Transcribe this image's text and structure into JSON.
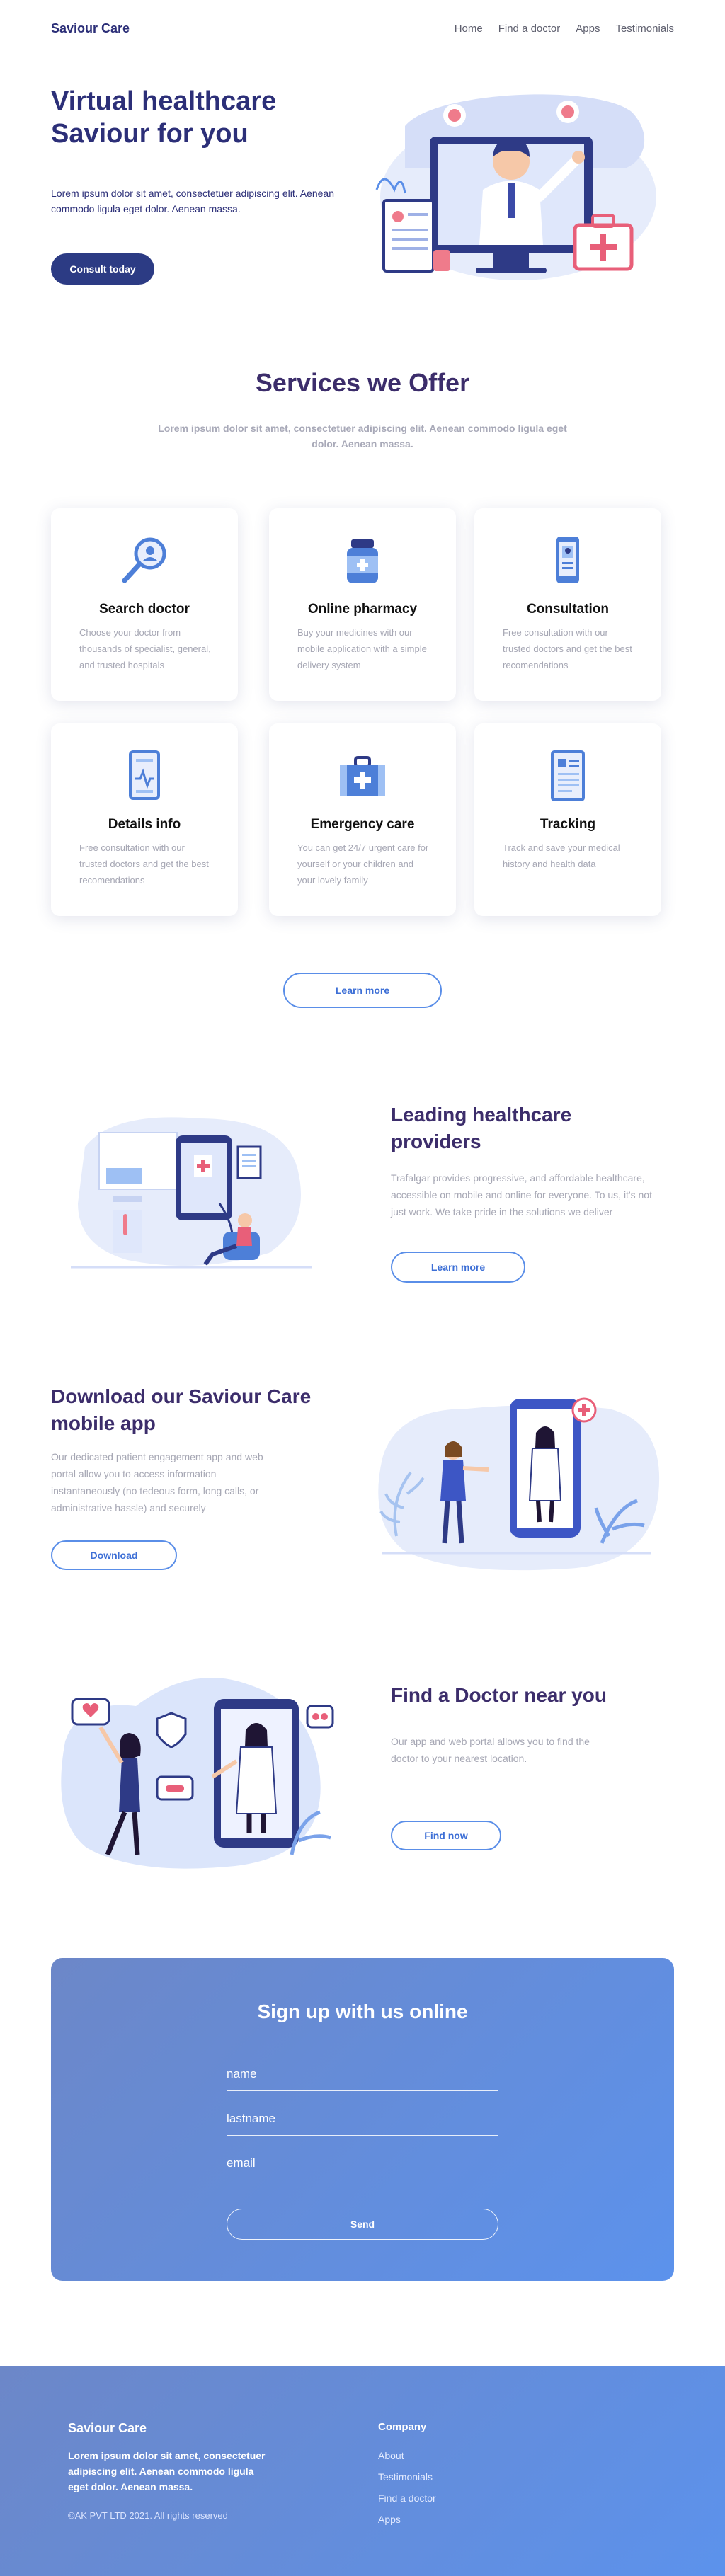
{
  "nav": {
    "brand": "Saviour Care",
    "links": [
      "Home",
      "Find a doctor",
      "Apps",
      "Testimonials"
    ]
  },
  "hero": {
    "title": "Virtual healthcare Saviour for you",
    "text": "Lorem ipsum dolor sit amet, consectetuer adipiscing elit. Aenean commodo ligula eget dolor. Aenean massa.",
    "button": "Consult today"
  },
  "services": {
    "title": "Services we Offer",
    "subtitle": "Lorem ipsum dolor sit amet, consectetuer adipiscing elit. Aenean commodo ligula eget dolor. Aenean massa.",
    "cards": [
      {
        "title": "Search doctor",
        "text": "Choose your doctor from thousands of specialist, general, and trusted hospitals",
        "icon": "search-doctor-icon"
      },
      {
        "title": "Online pharmacy",
        "text": "Buy your medicines with our mobile application with a simple delivery system",
        "icon": "pill-bottle-icon"
      },
      {
        "title": "Consultation",
        "text": "Free consultation with our trusted doctors and get the best recomendations",
        "icon": "phone-consultation-icon"
      },
      {
        "title": "Details info",
        "text": "Free consultation with our trusted doctors and get the best recomendations",
        "icon": "heart-monitor-icon"
      },
      {
        "title": "Emergency care",
        "text": "You can get 24/7 urgent care for yourself or your children and your lovely family",
        "icon": "medical-kit-icon"
      },
      {
        "title": "Tracking",
        "text": "Track and save your medical history and health data",
        "icon": "medical-record-icon"
      }
    ],
    "button": "Learn more"
  },
  "providers": {
    "title": "Leading healthcare providers",
    "text": "Trafalgar provides progressive, and affordable healthcare, accessible on mobile and online for everyone. To us, it's not just work. We take pride in the solutions we deliver",
    "button": "Learn more"
  },
  "download": {
    "title": "Download our Saviour Care mobile app",
    "text": "Our dedicated patient engagement app and web portal allow you to access information instantaneously (no tedeous form, long calls, or administrative hassle) and securely",
    "button": "Download"
  },
  "finddoctor": {
    "title": "Find a Doctor near you",
    "text": "Our app and web portal allows you to find the doctor to your nearest location.",
    "button": "Find now"
  },
  "signup": {
    "title": "Sign up with us online",
    "fields": [
      "name",
      "lastname",
      "email"
    ],
    "button": "Send"
  },
  "footer": {
    "brand": "Saviour Care",
    "description": "Lorem ipsum dolor sit amet, consectetuer adipiscing elit. Aenean commodo ligula eget dolor. Aenean massa.",
    "copyright": "©AK PVT LTD 2021. All rights reserved",
    "company_heading": "Company",
    "links": [
      "About",
      "Testimonials",
      "Find a doctor",
      "Apps"
    ]
  },
  "colors": {
    "brand_navy": "#2c2f78",
    "heading_purple": "#3c2d6b",
    "button_navy": "#2c3b84",
    "accent_blue": "#5a8ee8",
    "gradient_start": "#6c87c8",
    "gradient_end": "#5c92ec"
  }
}
